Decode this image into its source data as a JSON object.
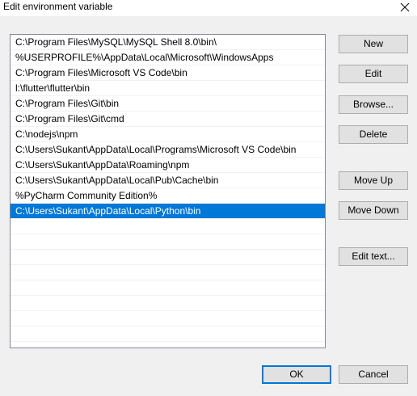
{
  "window": {
    "title": "Edit environment variable",
    "close_icon": "close-icon"
  },
  "paths": [
    "C:\\Program Files\\MySQL\\MySQL Shell 8.0\\bin\\",
    "%USERPROFILE%\\AppData\\Local\\Microsoft\\WindowsApps",
    "C:\\Program Files\\Microsoft VS Code\\bin",
    "l:\\flutter\\flutter\\bin",
    "C:\\Program Files\\Git\\bin",
    "C:\\Program Files\\Git\\cmd",
    "C:\\nodejs\\npm",
    "C:\\Users\\Sukant\\AppData\\Local\\Programs\\Microsoft VS Code\\bin",
    "C:\\Users\\Sukant\\AppData\\Roaming\\npm",
    "C:\\Users\\Sukant\\AppData\\Local\\Pub\\Cache\\bin",
    "%PyCharm Community Edition%",
    "C:\\Users\\Sukant\\AppData\\Local\\Python\\bin"
  ],
  "selected_index": 11,
  "buttons": {
    "new": "New",
    "edit": "Edit",
    "browse": "Browse...",
    "delete": "Delete",
    "move_up": "Move Up",
    "move_down": "Move Down",
    "edit_text": "Edit text...",
    "ok": "OK",
    "cancel": "Cancel"
  },
  "colors": {
    "selection": "#0078d7",
    "default_button_border": "#0078d7"
  }
}
